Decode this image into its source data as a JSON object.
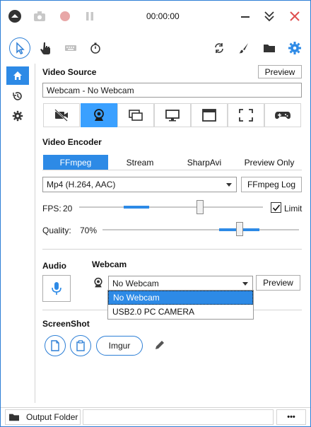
{
  "window": {
    "timer": "00:00:00"
  },
  "icons": {
    "menu": "circle-up-arrow-icon",
    "camera": "camera-icon",
    "record": "record-icon",
    "pause": "pause-icon",
    "minimize": "minimize-icon",
    "collapse": "double-chevron-down-icon",
    "close": "close-icon"
  },
  "video_source": {
    "title": "Video Source",
    "preview_label": "Preview",
    "value": "Webcam  -  No Webcam",
    "sources": [
      "no-video",
      "webcam",
      "screen-region",
      "full-screen",
      "window",
      "region",
      "gamepad"
    ],
    "active_source": "webcam"
  },
  "video_encoder": {
    "title": "Video Encoder",
    "tabs": [
      "FFmpeg",
      "Stream",
      "SharpAvi",
      "Preview Only"
    ],
    "active_tab": "FFmpeg",
    "codec": "Mp4 (H.264, AAC)",
    "log_label": "FFmpeg Log",
    "fps_label": "FPS:",
    "fps_value": "20",
    "limit_label": "Limit",
    "limit_checked": true,
    "quality_label": "Quality:",
    "quality_value": "70%"
  },
  "audio": {
    "title": "Audio"
  },
  "webcam": {
    "title": "Webcam",
    "selected": "No Webcam",
    "preview_label": "Preview",
    "options": [
      "No Webcam",
      "USB2.0 PC CAMERA"
    ]
  },
  "screenshot": {
    "title": "ScreenShot",
    "imgur_label": "Imgur"
  },
  "status": {
    "output_folder": "Output Folder",
    "more": "•••"
  },
  "colors": {
    "accent": "#2d8ae6",
    "accent_light": "#3aa0ff",
    "close": "#e04f4f"
  }
}
